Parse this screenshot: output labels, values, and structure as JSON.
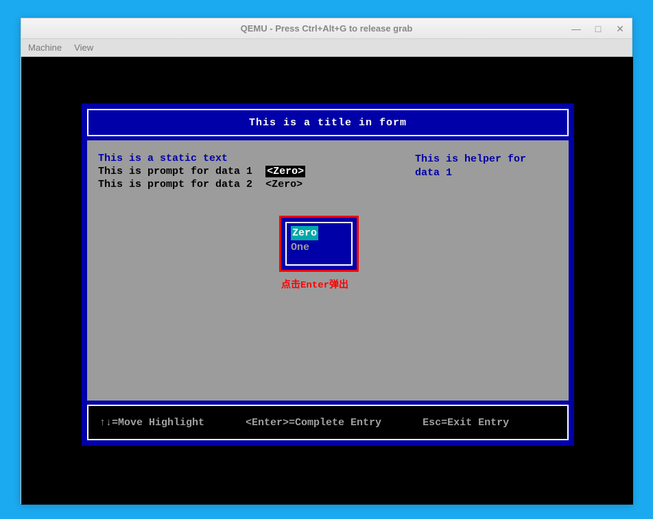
{
  "window": {
    "title": "QEMU - Press Ctrl+Alt+G to release grab",
    "controls": {
      "minimize": "—",
      "maximize": "□",
      "close": "✕"
    }
  },
  "menubar": {
    "items": [
      "Machine",
      "View"
    ]
  },
  "bios": {
    "title": "This is a title in form",
    "static_text": "This is a static text",
    "prompts": [
      {
        "label": "This is prompt for data 1",
        "value": "<Zero>",
        "selected": true
      },
      {
        "label": "This is prompt for data 2",
        "value": "<Zero>",
        "selected": false
      }
    ],
    "helper": "This is helper for\ndata 1",
    "popup": {
      "items": [
        "Zero",
        "One"
      ],
      "highlighted_index": 0,
      "caption": "点击Enter弹出"
    },
    "footer": {
      "move": "↑↓=Move Highlight",
      "enter": "<Enter>=Complete Entry",
      "esc": "Esc=Exit Entry"
    }
  }
}
